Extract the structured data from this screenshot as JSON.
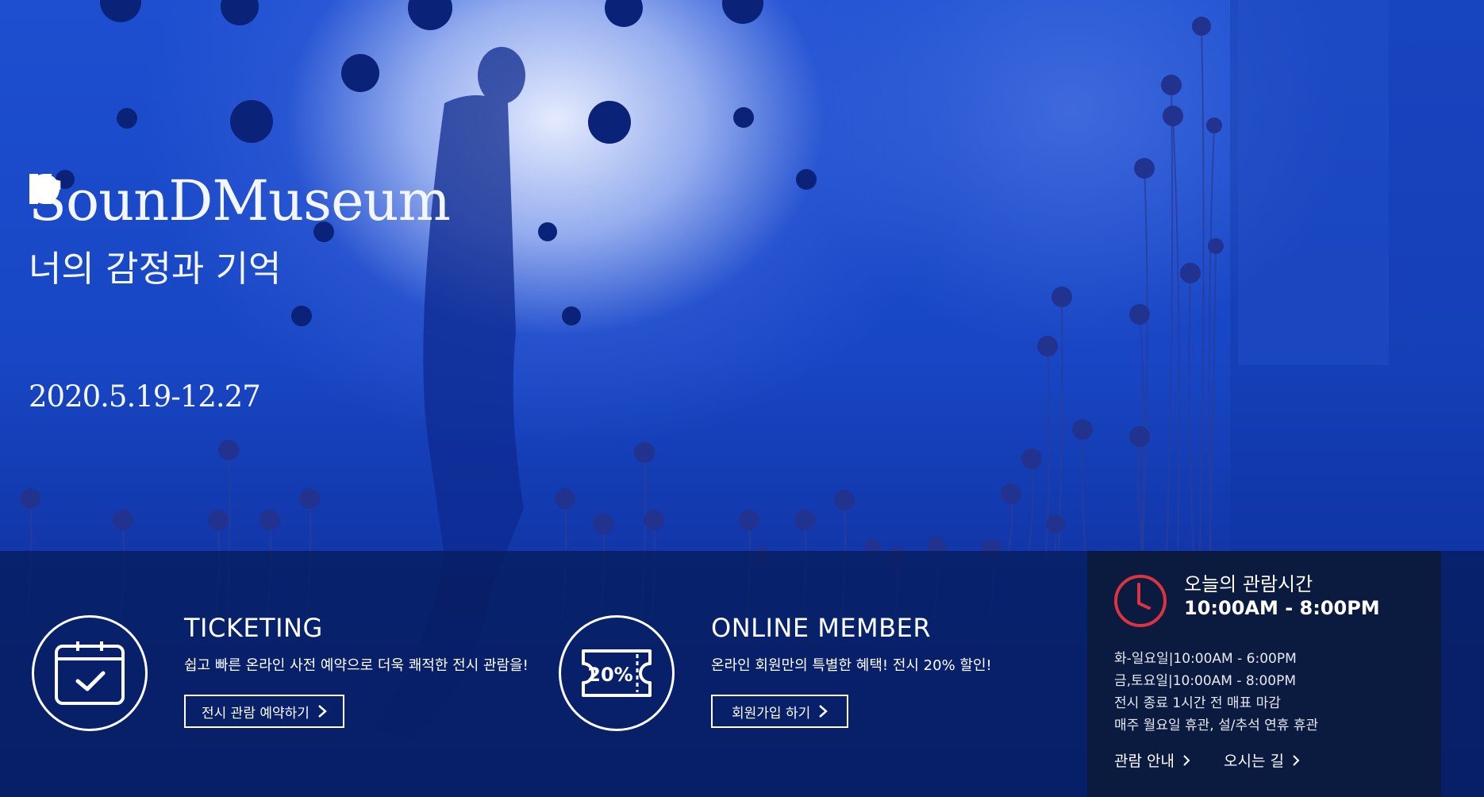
{
  "hero": {
    "logo": "SounDMuseum",
    "tagline": "너의 감정과 기억",
    "dates": "2020.5.19-12.27",
    "player_icons": [
      "play-icon",
      "pause-icon",
      "record-icon"
    ]
  },
  "features": [
    {
      "icon": "calendar-check-icon",
      "title": "TICKETING",
      "description": "쉽고 빠른 온라인 사전 예약으로 더욱 쾌적한 전시 관람을!",
      "button": "전시 관람 예약하기"
    },
    {
      "icon": "ticket-20-percent-icon",
      "icon_text": "20%",
      "title": "ONLINE MEMBER",
      "description": "온라인 회원만의 특별한 혜택! 전시 20% 할인!",
      "button": "회원가입 하기"
    }
  ],
  "hours_panel": {
    "icon": "clock-icon",
    "title": "오늘의 관람시간",
    "today_hours": "10:00AM - 8:00PM",
    "info": [
      "화-일요일|10:00AM - 6:00PM",
      "금,토요일|10:00AM - 8:00PM",
      "전시 종료 1시간 전 매표 마감",
      "매주 월요일 휴관, 설/추석 연휴 휴관"
    ],
    "links": [
      "관람 안내",
      "오시는 길"
    ]
  },
  "colors": {
    "hero_blue": "#1846c4",
    "bar_navy": "#061c5c",
    "panel_navy": "#0b1a3f",
    "clock_red": "#d9343f"
  }
}
